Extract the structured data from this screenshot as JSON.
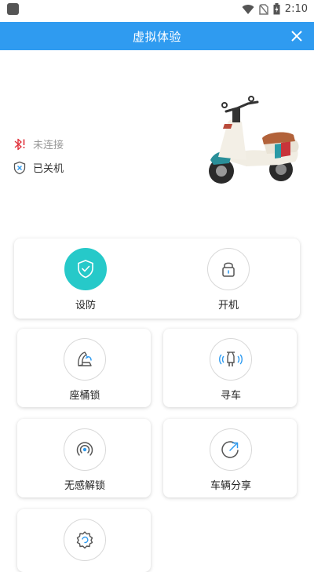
{
  "statusbar": {
    "time": "2:10"
  },
  "header": {
    "title": "虚拟体验"
  },
  "status": {
    "bluetooth": "未连接",
    "power": "已关机"
  },
  "actions": {
    "arm": "设防",
    "power_on": "开机",
    "seat_lock": "座桶锁",
    "find_vehicle": "寻车",
    "keyless_unlock": "无感解锁",
    "share_vehicle": "车辆分享"
  },
  "colors": {
    "titlebar": "#2f9bf0",
    "active": "#26c9c9",
    "bluetooth_alert": "#e0303a",
    "icon_accent": "#2f9bf0"
  }
}
